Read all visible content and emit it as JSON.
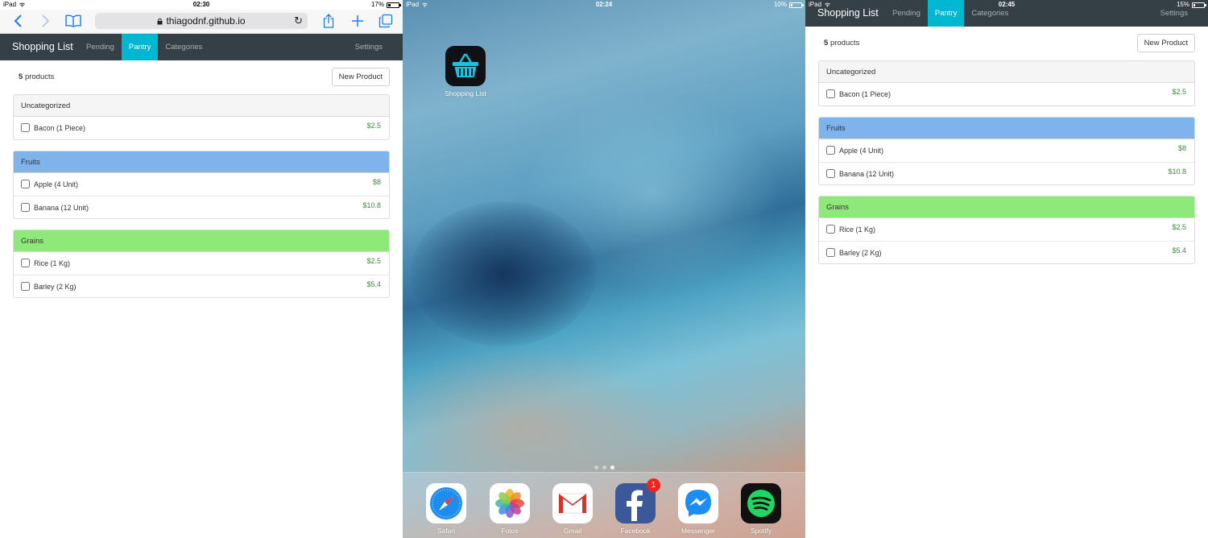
{
  "left_screen": {
    "status": {
      "device": "iPad",
      "time": "02:30",
      "battery": "17%",
      "battery_level": 0.17
    },
    "safari": {
      "url": "thiagodnf.github.io"
    },
    "nav": {
      "brand": "Shopping List",
      "links": [
        "Pending",
        "Pantry",
        "Categories"
      ],
      "active": "Pantry",
      "settings": "Settings"
    },
    "count_num": "5",
    "count_text": "products",
    "new_product": "New Product"
  },
  "home_screen": {
    "status": {
      "device": "iPad",
      "time": "02:24",
      "battery": "10%",
      "battery_level": 0.1
    },
    "app": {
      "label": "Shopping List",
      "icon": "shopping-basket-icon"
    },
    "page_dots": 3,
    "current_page": 3,
    "dock": [
      {
        "label": "Safari",
        "icon": "safari-icon"
      },
      {
        "label": "Fotos",
        "icon": "photos-icon"
      },
      {
        "label": "Gmail",
        "icon": "gmail-icon"
      },
      {
        "label": "Facebook",
        "icon": "facebook-icon",
        "badge": "1"
      },
      {
        "label": "Messenger",
        "icon": "messenger-icon"
      },
      {
        "label": "Spotify",
        "icon": "spotify-icon"
      }
    ]
  },
  "right_screen": {
    "status": {
      "device": "iPad",
      "time": "02:45",
      "battery": "15%",
      "battery_level": 0.15
    },
    "nav": {
      "brand": "Shopping List",
      "links": [
        "Pending",
        "Pantry",
        "Categories"
      ],
      "active": "Pantry",
      "settings": "Settings"
    },
    "count_num": "5",
    "count_text": "products",
    "new_product": "New Product"
  },
  "categories": [
    {
      "name": "Uncategorized",
      "color": "#f5f5f5",
      "items": [
        {
          "name": "Bacon (1 Piece)",
          "price": "$2.5"
        }
      ]
    },
    {
      "name": "Fruits",
      "color": "#7eb3ec",
      "items": [
        {
          "name": "Apple (4 Unit)",
          "price": "$8"
        },
        {
          "name": "Banana (12 Unit)",
          "price": "$10.8"
        }
      ]
    },
    {
      "name": "Grains",
      "color": "#8fe87a",
      "items": [
        {
          "name": "Rice (1 Kg)",
          "price": "$2.5"
        },
        {
          "name": "Barley (2 Kg)",
          "price": "$5.4"
        }
      ]
    }
  ],
  "colors": {
    "navbar": "#343f46",
    "active_tab": "#00b7d2",
    "price": "#3c8a3c",
    "safari_blue": "#1a7cf5"
  }
}
